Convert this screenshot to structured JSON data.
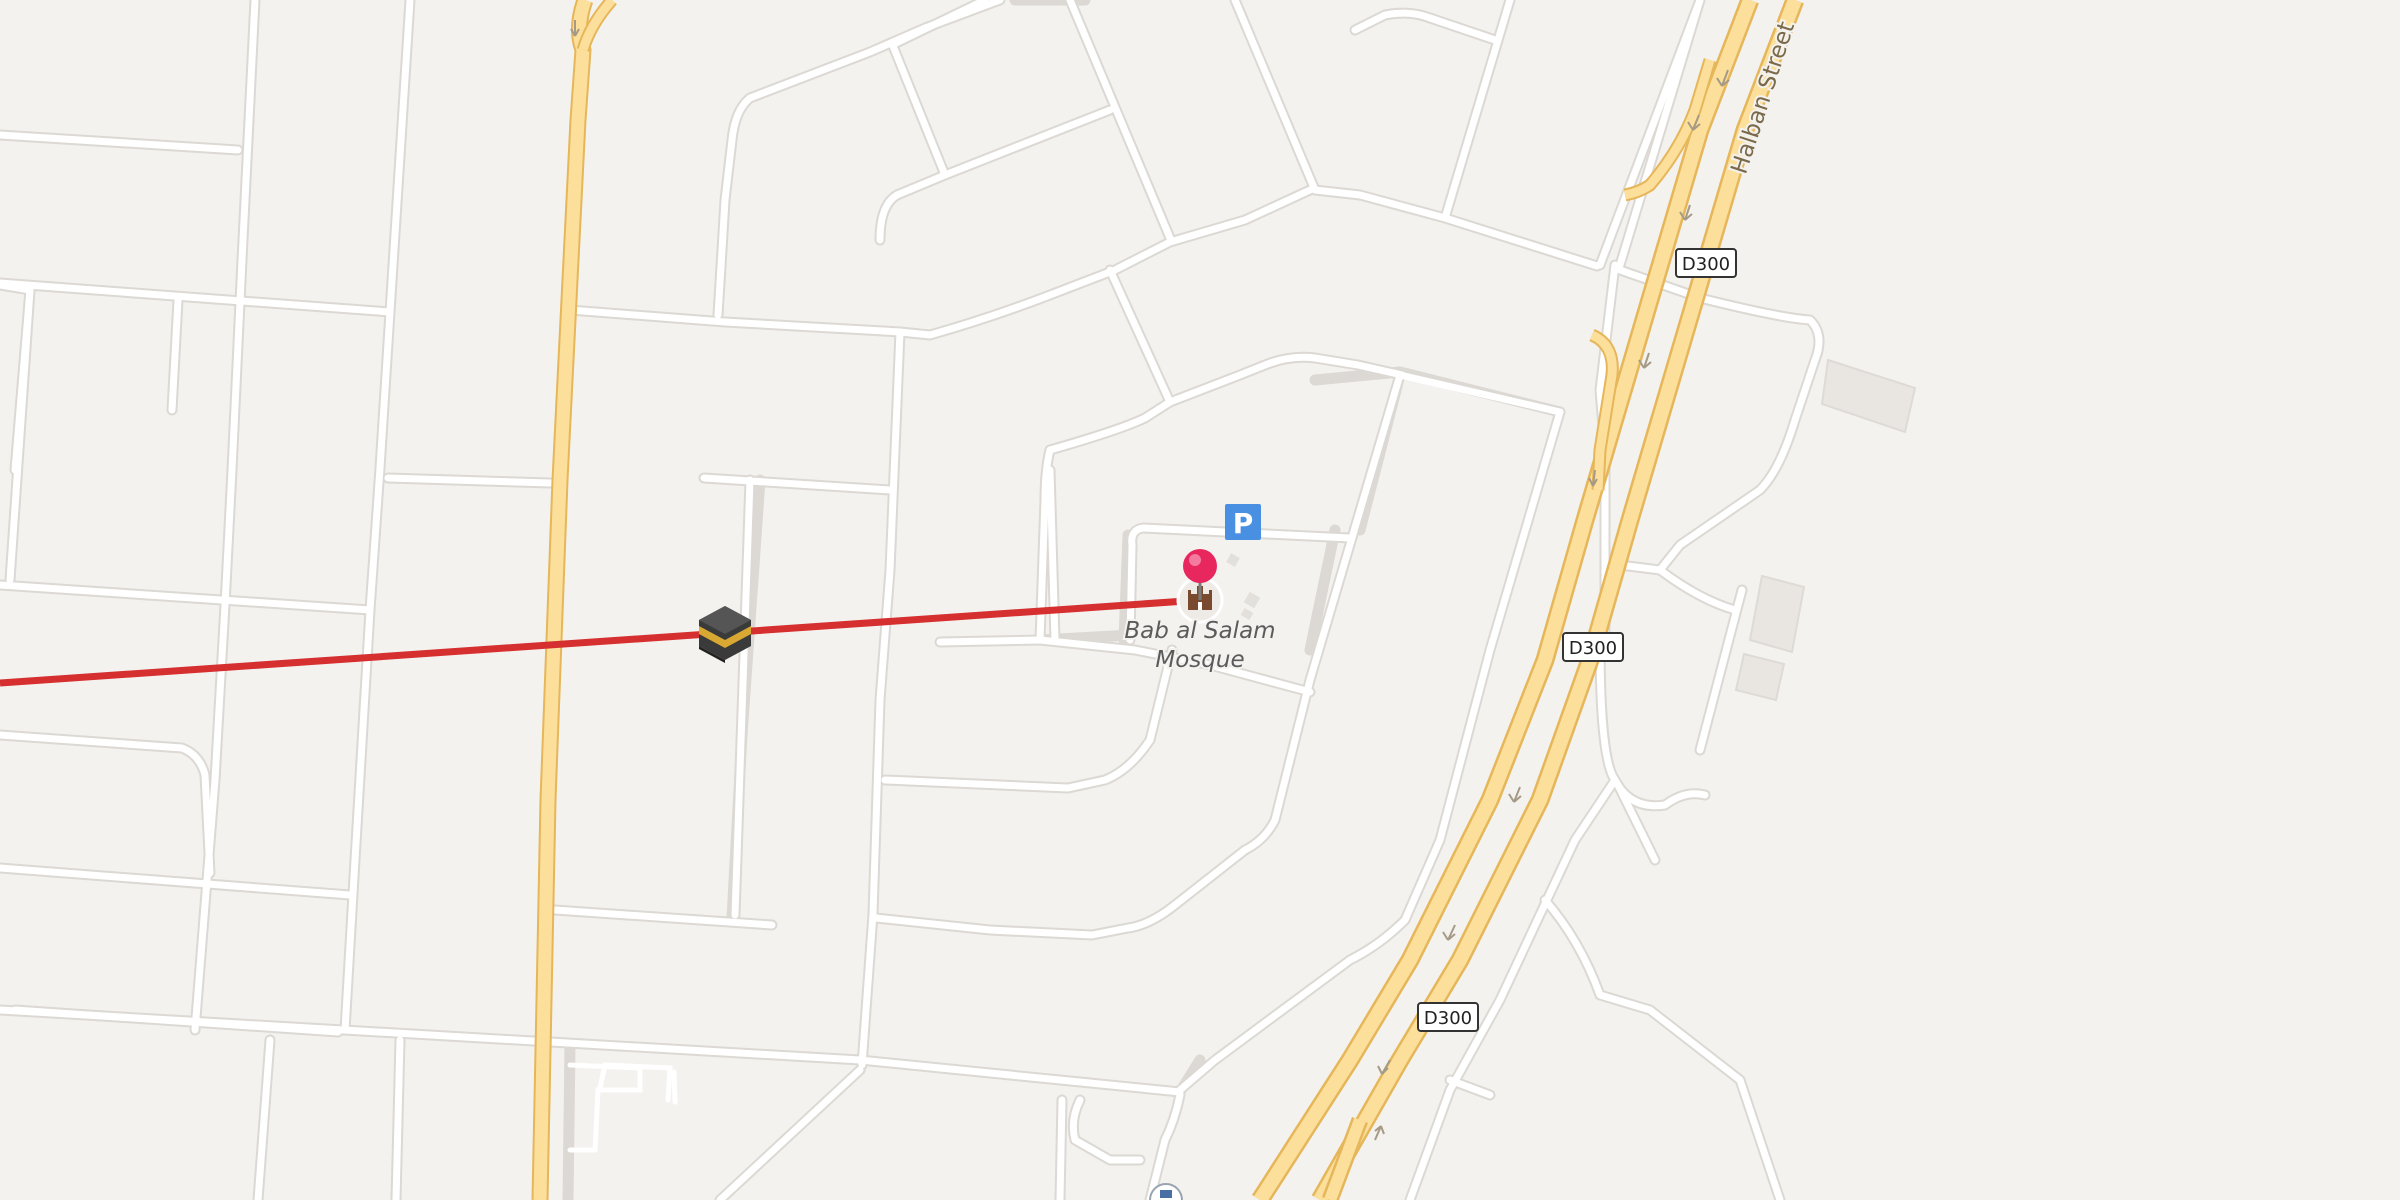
{
  "map": {
    "colors": {
      "land": "#f4f2ef",
      "minor_road": "#ffffff",
      "minor_road_casing": "#dcd8d3",
      "major_road": "#fcdf9a",
      "major_road_casing": "#e6b65a",
      "route_line": "#d62f2f",
      "building": "#e9e5e0",
      "parking": "#4a90e2",
      "pin": "#e8275f",
      "label": "#5b5b5b"
    },
    "highway_shields": [
      {
        "id": "d300-a",
        "label": "D300"
      },
      {
        "id": "d300-b",
        "label": "D300"
      },
      {
        "id": "d300-c",
        "label": "D300"
      }
    ],
    "street_labels": [
      {
        "id": "halban-street",
        "label": "Halban Street"
      }
    ],
    "poi": {
      "name_line1": "Bab al Salam",
      "name_line2": "Mosque",
      "icon": "mosque-icon",
      "pin_icon": "location-pin-icon"
    },
    "parking": {
      "label": "P",
      "icon": "parking-icon"
    },
    "route_marker": {
      "icon": "kaaba-icon"
    }
  }
}
